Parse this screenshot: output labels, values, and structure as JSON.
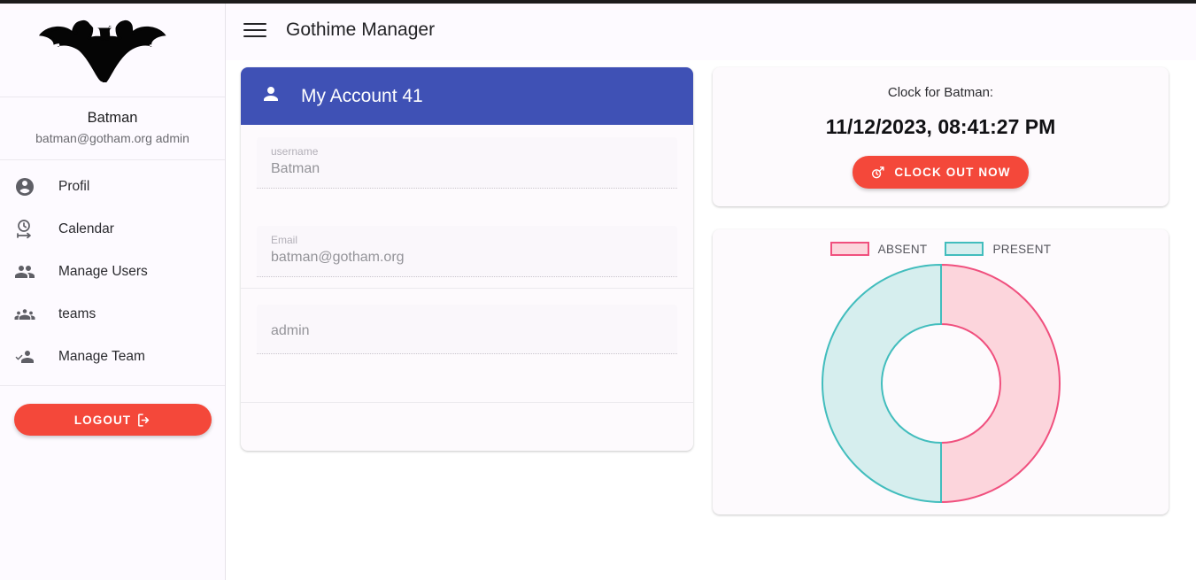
{
  "app": {
    "title": "Gothime Manager",
    "menu_icon": "hamburger-menu-icon"
  },
  "sidebar": {
    "logo": "batman-logo",
    "user": {
      "name": "Batman",
      "email_role": "batman@gotham.org admin"
    },
    "items": [
      {
        "label": "Profil",
        "icon": "account-circle-icon"
      },
      {
        "label": "Calendar",
        "icon": "timer-clock-icon"
      },
      {
        "label": "Manage Users",
        "icon": "people-icon"
      },
      {
        "label": "teams",
        "icon": "groups-icon"
      },
      {
        "label": "Manage Team",
        "icon": "how-to-reg-icon"
      }
    ],
    "logout": {
      "label": "LOGOUT",
      "icon": "logout-icon"
    }
  },
  "account_card": {
    "header_title": "My Account 41",
    "header_icon": "person-icon",
    "header_color": "#3f51b5",
    "fields": [
      {
        "label": "username",
        "value": "Batman"
      },
      {
        "label": "Email",
        "value": "batman@gotham.org"
      }
    ],
    "role_field": {
      "label": "",
      "value": "admin"
    }
  },
  "clock_card": {
    "heading": "Clock for Batman:",
    "timestamp": "11/12/2023, 08:41:27 PM",
    "button_label": "CLOCK OUT NOW",
    "button_icon": "clock-out-icon",
    "button_color": "#f4483a"
  },
  "chart_data": {
    "type": "pie",
    "title": "",
    "legend_position": "top",
    "labels": [
      "ABSENT",
      "PRESENT"
    ],
    "values": [
      50,
      50
    ],
    "colors": [
      "#fcd5dc",
      "#d6eeee"
    ],
    "border_colors": [
      "#f0507e",
      "#42bdbd"
    ],
    "donut": true,
    "cutout_percent": 50
  }
}
